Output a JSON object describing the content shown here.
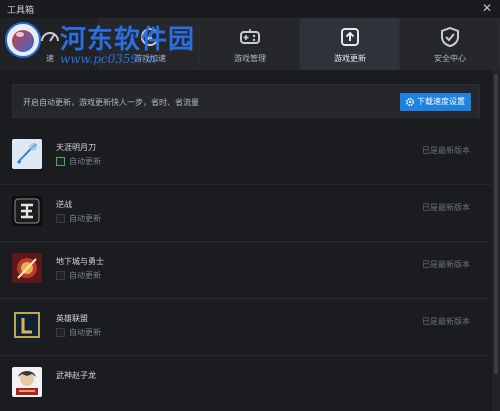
{
  "window": {
    "title": "工具箱",
    "close_glyph": "✕"
  },
  "tabs": [
    {
      "label": "速",
      "icon": "speed-icon"
    },
    {
      "label": "游戏加速",
      "icon": "rocket-icon"
    },
    {
      "label": "游戏管理",
      "icon": "gamepad-icon"
    },
    {
      "label": "游戏更新",
      "icon": "update-icon",
      "active": true
    },
    {
      "label": "安全中心",
      "icon": "shield-check-icon"
    }
  ],
  "watermark": {
    "name": "河东软件园",
    "url": "www.pc0359.cn"
  },
  "banner": {
    "text": "开启自动更新，游戏更新快人一步，省时、省流量",
    "button_label": "下载速度设置",
    "button_icon": "gear-icon",
    "accent": "#1f82e0"
  },
  "games": [
    {
      "name": "天涯明月刀",
      "auto_update_label": "自动更新",
      "auto_update": true,
      "status": "已是最新版本"
    },
    {
      "name": "逆战",
      "auto_update_label": "自动更新",
      "auto_update": false,
      "status": "已是最新版本"
    },
    {
      "name": "地下城与勇士",
      "auto_update_label": "自动更新",
      "auto_update": false,
      "status": "已是最新版本"
    },
    {
      "name": "英雄联盟",
      "auto_update_label": "自动更新",
      "auto_update": false,
      "status": "已是最新版本"
    },
    {
      "name": "武神赵子龙"
    }
  ]
}
